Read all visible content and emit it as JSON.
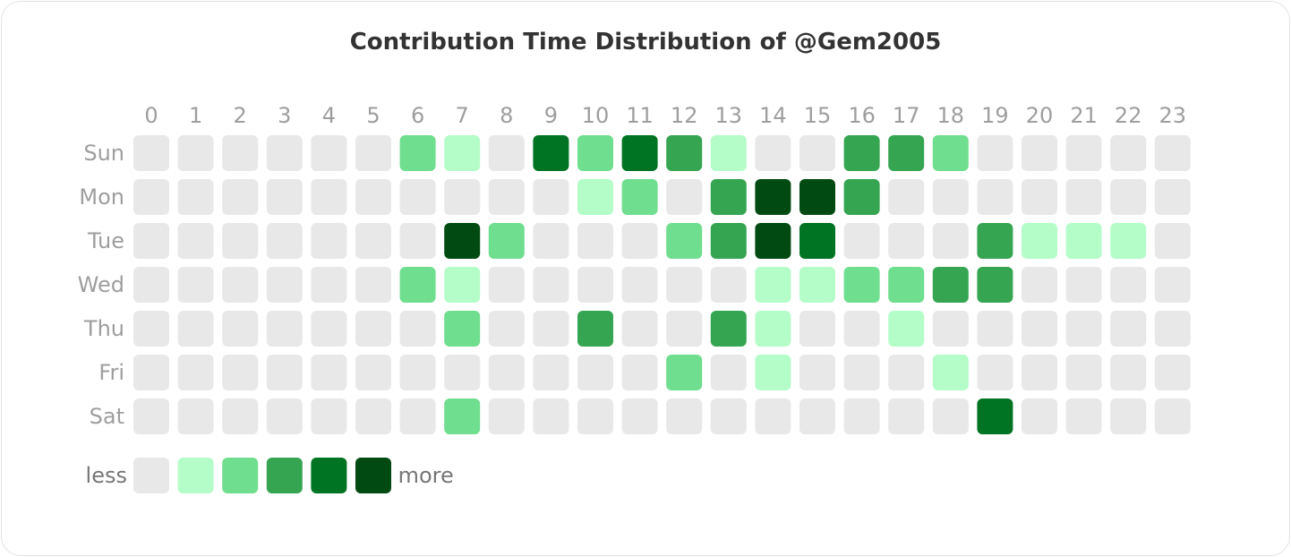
{
  "chart_data": {
    "type": "heatmap",
    "title": "Contribution Time Distribution of @Gem2005",
    "xlabel": "",
    "ylabel": "",
    "x_categories": [
      "0",
      "1",
      "2",
      "3",
      "4",
      "5",
      "6",
      "7",
      "8",
      "9",
      "10",
      "11",
      "12",
      "13",
      "14",
      "15",
      "16",
      "17",
      "18",
      "19",
      "20",
      "21",
      "22",
      "23"
    ],
    "y_categories": [
      "Sun",
      "Mon",
      "Tue",
      "Wed",
      "Thu",
      "Fri",
      "Sat"
    ],
    "levels": 6,
    "colors": [
      "#e8e8e8",
      "#b4fdc9",
      "#6fde8e",
      "#36a552",
      "#007423",
      "#014b12"
    ],
    "values": [
      [
        0,
        0,
        0,
        0,
        0,
        0,
        2,
        1,
        0,
        4,
        2,
        4,
        3,
        1,
        0,
        0,
        3,
        3,
        2,
        0,
        0,
        0,
        0,
        0
      ],
      [
        0,
        0,
        0,
        0,
        0,
        0,
        0,
        0,
        0,
        0,
        1,
        2,
        0,
        3,
        5,
        5,
        3,
        0,
        0,
        0,
        0,
        0,
        0,
        0
      ],
      [
        0,
        0,
        0,
        0,
        0,
        0,
        0,
        5,
        2,
        0,
        0,
        0,
        2,
        3,
        5,
        4,
        0,
        0,
        0,
        3,
        1,
        1,
        1,
        0
      ],
      [
        0,
        0,
        0,
        0,
        0,
        0,
        2,
        1,
        0,
        0,
        0,
        0,
        0,
        0,
        1,
        1,
        2,
        2,
        3,
        3,
        0,
        0,
        0,
        0
      ],
      [
        0,
        0,
        0,
        0,
        0,
        0,
        0,
        2,
        0,
        0,
        3,
        0,
        0,
        3,
        1,
        0,
        0,
        1,
        0,
        0,
        0,
        0,
        0,
        0
      ],
      [
        0,
        0,
        0,
        0,
        0,
        0,
        0,
        0,
        0,
        0,
        0,
        0,
        2,
        0,
        1,
        0,
        0,
        0,
        1,
        0,
        0,
        0,
        0,
        0
      ],
      [
        0,
        0,
        0,
        0,
        0,
        0,
        0,
        2,
        0,
        0,
        0,
        0,
        0,
        0,
        0,
        0,
        0,
        0,
        0,
        4,
        0,
        0,
        0,
        0
      ]
    ],
    "legend": {
      "low_label": "less",
      "high_label": "more",
      "placement": "bottom-left"
    },
    "grid": false
  }
}
